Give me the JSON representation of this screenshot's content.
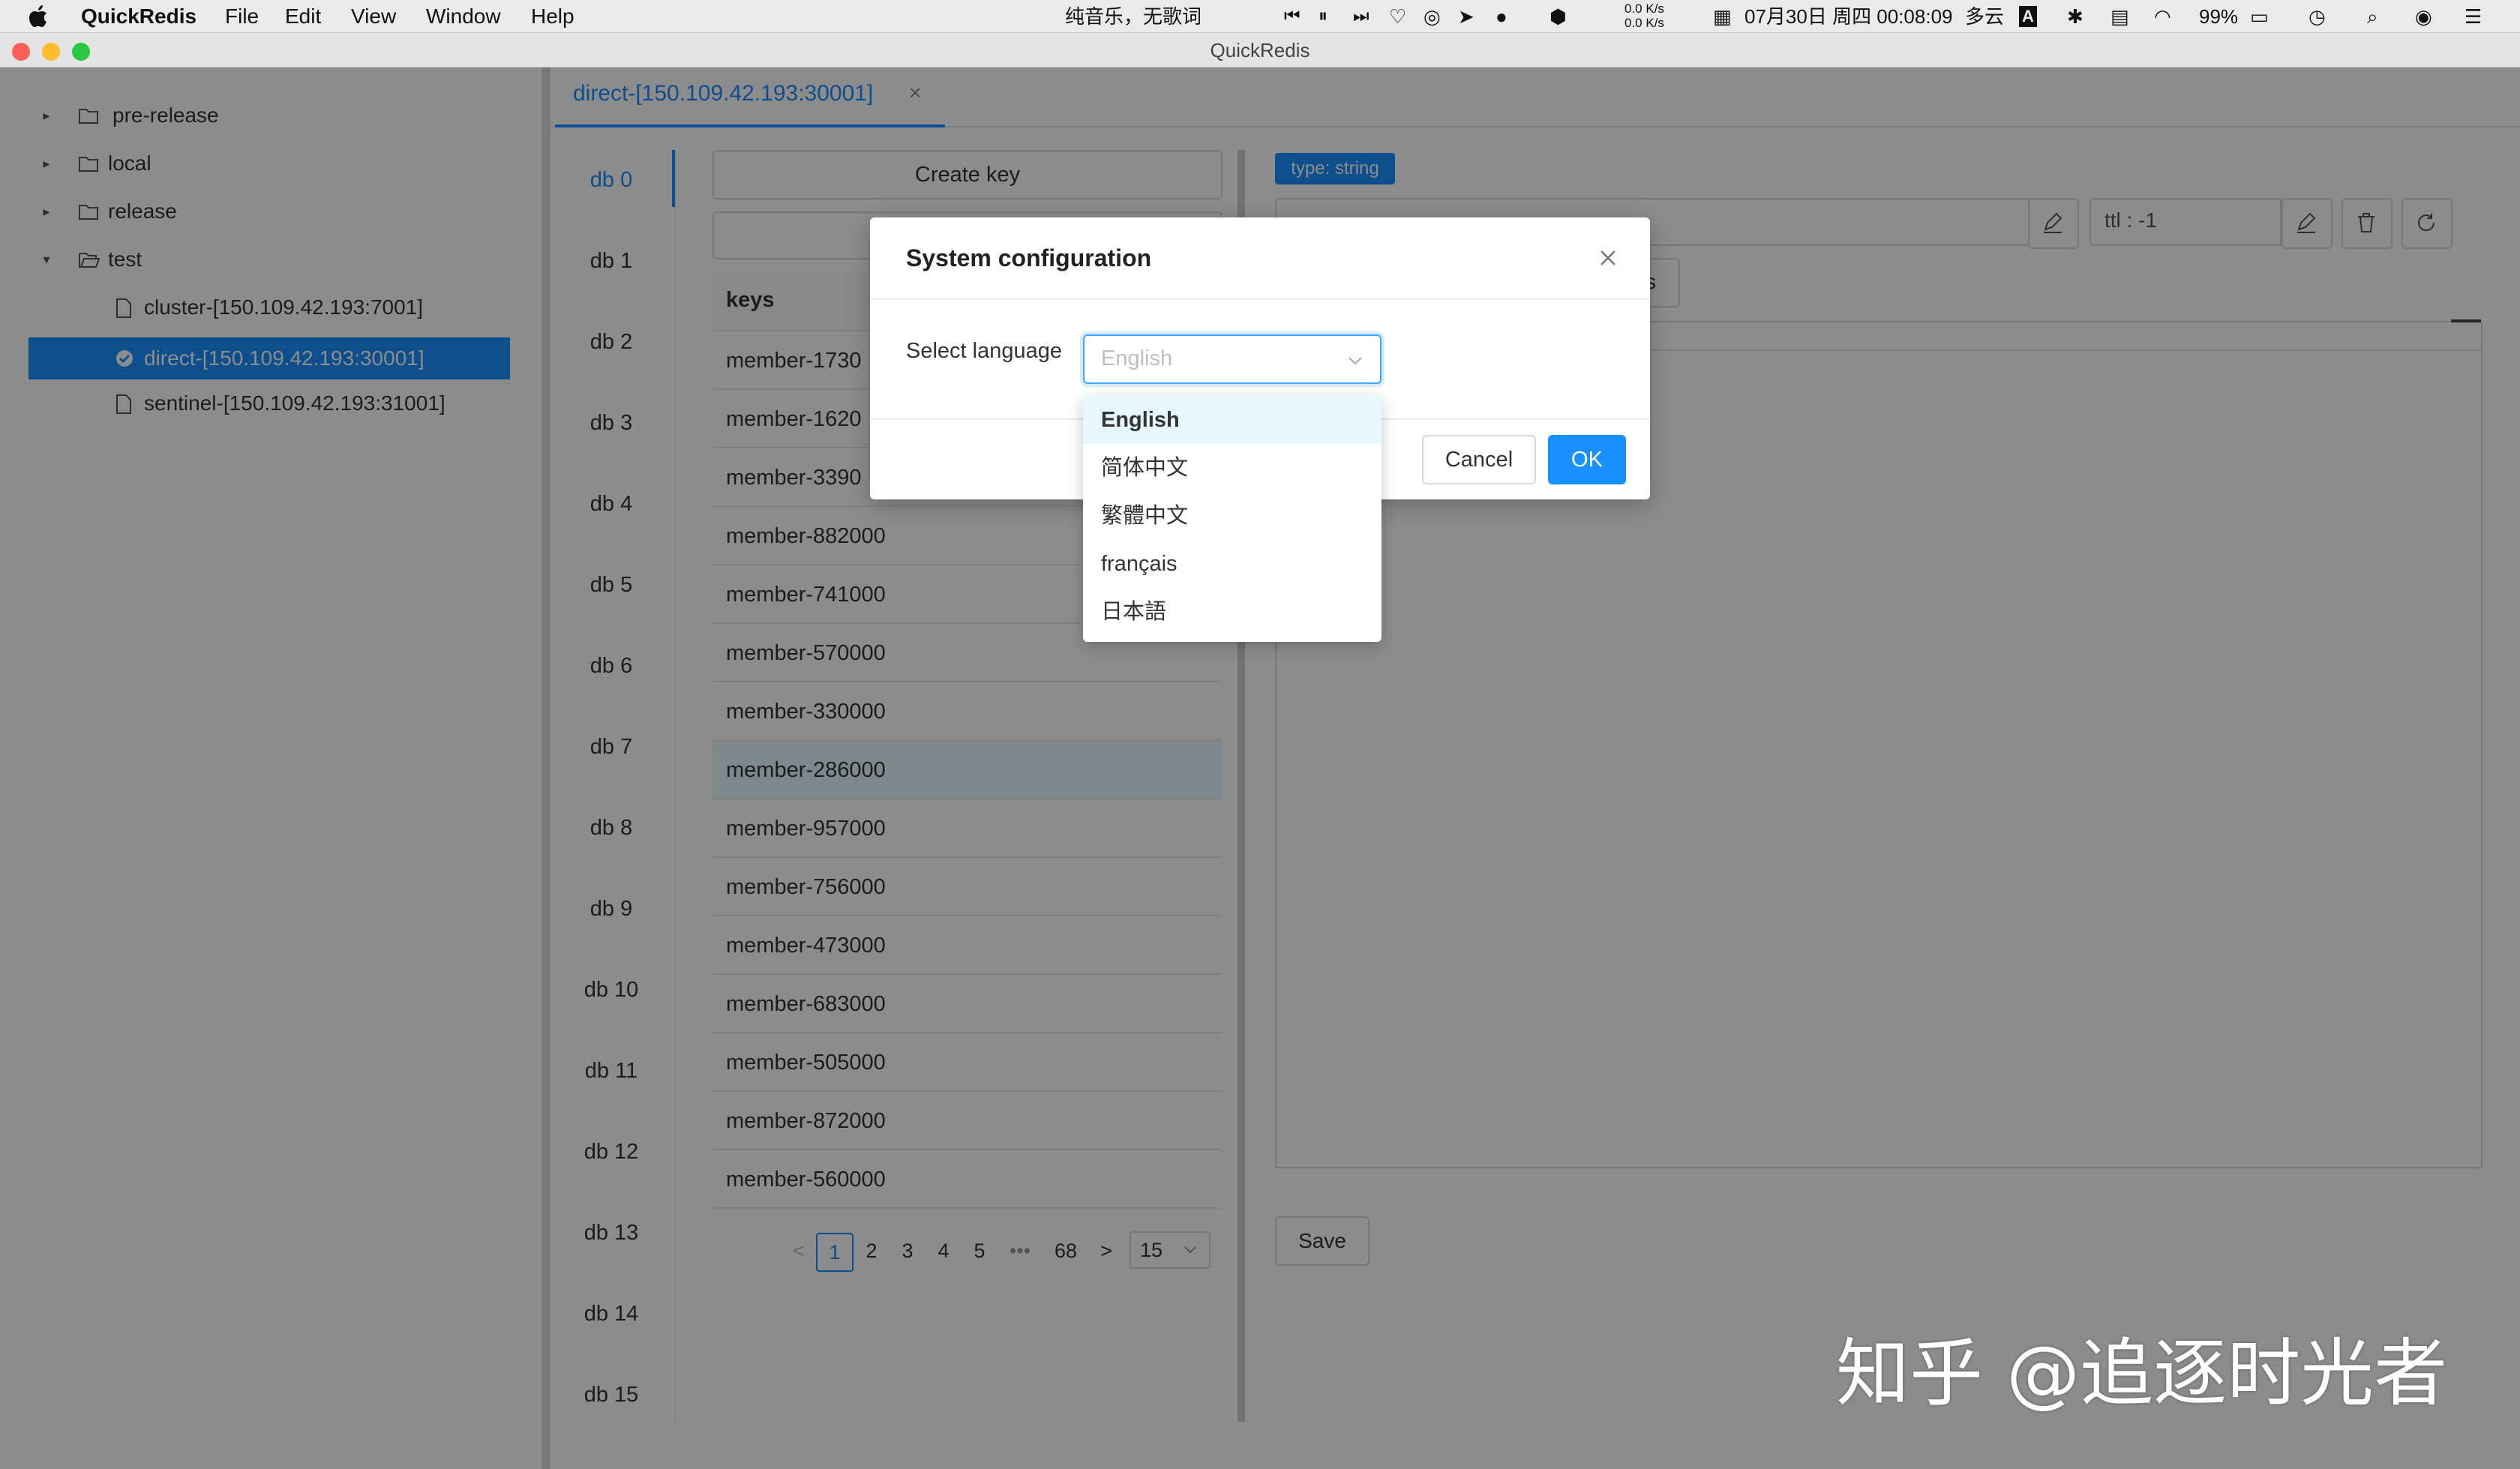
{
  "menubar": {
    "app_name": "QuickRedis",
    "menus": [
      "File",
      "Edit",
      "View",
      "Window",
      "Help"
    ],
    "now_playing": "纯音乐，无歌词",
    "net_speed_up": "0.0 K/s",
    "net_speed_down": "0.0 K/s",
    "datetime": "07月30日 周四 00:08:09",
    "weather": "多云",
    "input_method": "A",
    "battery": "99%"
  },
  "window": {
    "title": "QuickRedis",
    "traffic_lights": {
      "close": "#fe5f57",
      "minimize": "#febc2e",
      "zoom": "#28c840"
    }
  },
  "sidebar": {
    "groups": [
      {
        "label": "pre-release",
        "expanded": false
      },
      {
        "label": "local",
        "expanded": false
      },
      {
        "label": "release",
        "expanded": false
      },
      {
        "label": "test",
        "expanded": true
      }
    ],
    "connections": [
      {
        "label": "cluster-[150.109.42.193:7001]",
        "selected": false
      },
      {
        "label": "direct-[150.109.42.193:30001]",
        "selected": true
      },
      {
        "label": "sentinel-[150.109.42.193:31001]",
        "selected": false
      }
    ]
  },
  "tab": {
    "label": "direct-[150.109.42.193:30001]",
    "close": "×"
  },
  "databases": [
    "db 0",
    "db 1",
    "db 2",
    "db 3",
    "db 4",
    "db 5",
    "db 6",
    "db 7",
    "db 8",
    "db 9",
    "db 10",
    "db 11",
    "db 12",
    "db 13",
    "db 14",
    "db 15"
  ],
  "key_panel": {
    "create_key_label": "Create key",
    "column_header": "keys",
    "keys": [
      "member-1730",
      "member-1620",
      "member-3390",
      "member-882000",
      "member-741000",
      "member-570000",
      "member-330000",
      "member-286000",
      "member-957000",
      "member-756000",
      "member-473000",
      "member-683000",
      "member-505000",
      "member-872000",
      "member-560000"
    ],
    "highlighted_index": 7,
    "pagination": {
      "prev": "<",
      "pages": [
        "1",
        "2",
        "3",
        "4",
        "5"
      ],
      "ellipsis": "•••",
      "last": "68",
      "next": ">",
      "page_size": "15"
    }
  },
  "value_panel": {
    "type_tag": "type: string",
    "ttl": "ttl : -1",
    "view_button_tail": "s",
    "save_label": "Save"
  },
  "modal": {
    "title": "System configuration",
    "language_label": "Select language",
    "language_value": "English",
    "options": [
      "English",
      "简体中文",
      "繁體中文",
      "français",
      "日本語"
    ],
    "selected_option": 0,
    "cancel_label": "Cancel",
    "ok_label": "OK"
  },
  "watermark": "知乎 @追逐时光者",
  "colors": {
    "accent": "#1890ff",
    "selection_bg": "#e6f7ff",
    "overlay": "rgba(0,0,0,0.45)"
  }
}
